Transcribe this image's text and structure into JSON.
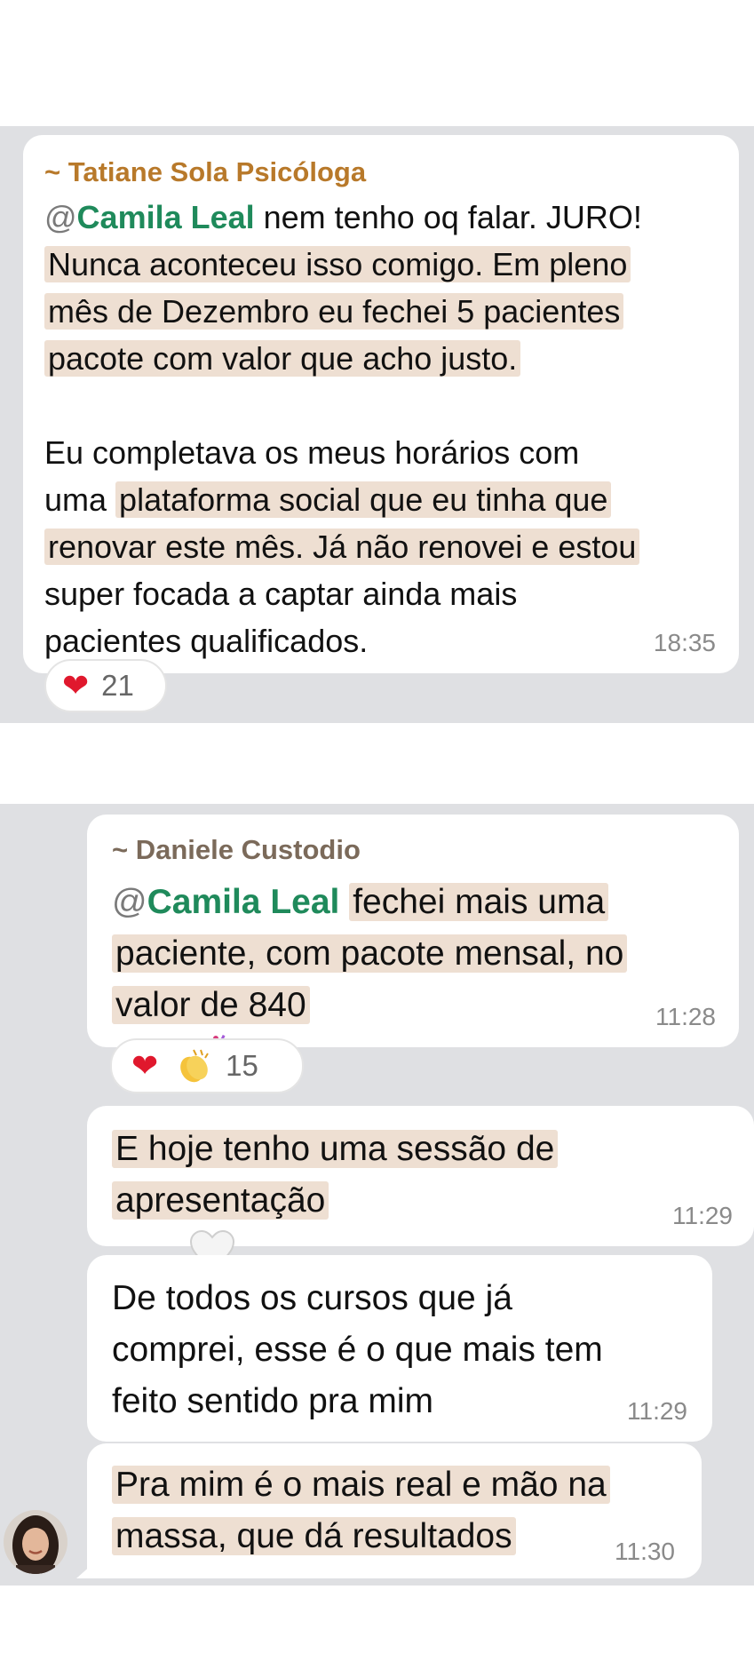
{
  "chat1": {
    "sender": "~ Tatiane Sola Psicóloga",
    "sender_color": "#b8792a",
    "mention": "Camila Leal",
    "line1_rest": " nem tenho oq falar. JURO!",
    "line2": "Nunca aconteceu isso comigo. Em pleno",
    "line3": "mês de Dezembro eu fechei 5 pacientes",
    "line4": "pacote com valor que acho justo.",
    "line5_plain": "Eu completava os meus horários com",
    "line6_plain": "uma ",
    "line6_hl": "plataforma social que eu tinha que",
    "line7": "renovar este mês. Já não renovei e estou",
    "line8": "super focada a captar ainda mais",
    "line9": "pacientes qualificados.",
    "time": "18:35",
    "reaction_count": "21"
  },
  "chat2": {
    "sender": "~ Daniele Custodio",
    "sender_color": "#7b6a5a",
    "msg1": {
      "mention": "Camila Leal",
      "line1_rest": "fechei mais uma",
      "line2": "paciente, com pacote mensal, no",
      "line3": "valor de 840",
      "time": "11:28",
      "reaction_count": "15"
    },
    "msg2": {
      "line1": "E hoje tenho uma sessão de",
      "line2": "apresentação",
      "time": "11:29"
    },
    "msg3": {
      "line1": "De todos os cursos que já",
      "line2": "comprei, esse é o que mais tem",
      "line3": "feito sentido pra mim",
      "time": "11:29"
    },
    "msg4": {
      "line1": "Pra mim é o mais real e mão na",
      "line2": "massa, que dá resultados",
      "time": "11:30"
    }
  },
  "colors": {
    "panel_bg": "#dfe0e3",
    "bubble_bg": "#ffffff",
    "mention": "#1f8a5b",
    "highlight": "#eedfd2",
    "heart": "#e0182d"
  },
  "icons": [
    "red-heart-icon",
    "clapping-hands-icon",
    "party-popper-icon",
    "white-heart-icon"
  ]
}
